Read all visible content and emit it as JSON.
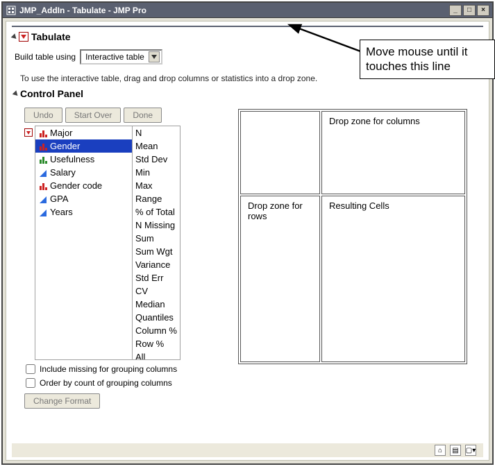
{
  "window": {
    "title": "JMP_AddIn - Tabulate - JMP Pro"
  },
  "tabulate_section": {
    "title": "Tabulate",
    "build_label": "Build table using",
    "build_value": "Interactive table",
    "instruction": "To use the interactive table, drag and drop columns or statistics into a drop zone."
  },
  "control_panel": {
    "title": "Control Panel",
    "buttons": {
      "undo": "Undo",
      "start_over": "Start Over",
      "done": "Done"
    },
    "columns": [
      {
        "label": "Major",
        "icon": "bar-red",
        "selected": false
      },
      {
        "label": "Gender",
        "icon": "bar-red",
        "selected": true
      },
      {
        "label": "Usefulness",
        "icon": "bar-green",
        "selected": false
      },
      {
        "label": "Salary",
        "icon": "tri-blue",
        "selected": false
      },
      {
        "label": "Gender code",
        "icon": "bar-red",
        "selected": false
      },
      {
        "label": "GPA",
        "icon": "tri-blue",
        "selected": false
      },
      {
        "label": "Years",
        "icon": "tri-blue",
        "selected": false
      }
    ],
    "stats": [
      "N",
      "Mean",
      "Std Dev",
      "Min",
      "Max",
      "Range",
      "% of Total",
      "N Missing",
      "Sum",
      "Sum Wgt",
      "Variance",
      "Std Err",
      "CV",
      "Median",
      "Quantiles",
      "Column %",
      "Row %",
      "All"
    ],
    "include_missing_label": "Include missing for grouping columns",
    "order_by_count_label": "Order by count of grouping columns",
    "change_format": "Change Format"
  },
  "drop_zones": {
    "cols": "Drop zone for columns",
    "rows": "Drop zone for rows",
    "cells": "Resulting Cells"
  },
  "annotation": {
    "text": "Move mouse until it touches this line"
  }
}
